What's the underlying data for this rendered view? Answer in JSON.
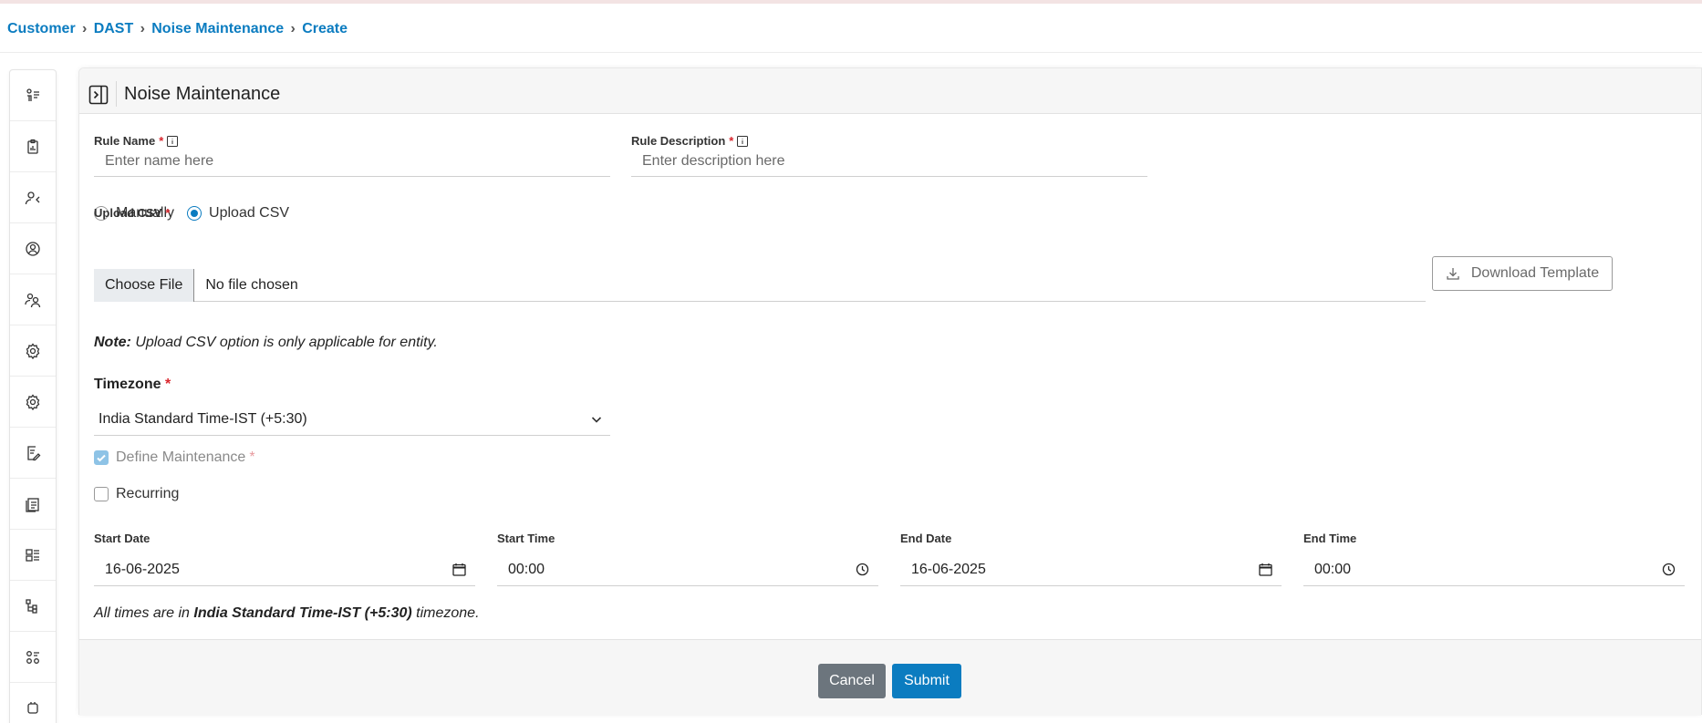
{
  "breadcrumb": {
    "items": [
      "Customer",
      "DAST",
      "Noise Maintenance",
      "Create"
    ],
    "separator": "›"
  },
  "sidebar": {
    "items": [
      {
        "icon": "person-list-icon"
      },
      {
        "icon": "clipboard-icon"
      },
      {
        "icon": "user-arrow-icon"
      },
      {
        "icon": "user-circle-icon"
      },
      {
        "icon": "users-icon"
      },
      {
        "icon": "gear-icon"
      },
      {
        "icon": "gear-alt-icon"
      },
      {
        "icon": "document-edit-icon"
      },
      {
        "icon": "document-list-icon"
      },
      {
        "icon": "stack-icon"
      },
      {
        "icon": "hierarchy-icon"
      },
      {
        "icon": "grid-list-icon"
      },
      {
        "icon": "badge-icon"
      }
    ]
  },
  "card": {
    "title": "Noise Maintenance"
  },
  "form": {
    "rule_name": {
      "label": "Rule Name",
      "required": "*",
      "placeholder": "Enter name here",
      "value": ""
    },
    "rule_description": {
      "label": "Rule Description",
      "required": "*",
      "placeholder": "Enter description here",
      "value": ""
    },
    "input_mode": {
      "options": [
        "Manually",
        "Upload CSV"
      ],
      "selected": "Upload CSV"
    },
    "upload_csv": {
      "label": "Upload CSV",
      "required": "*",
      "button": "Choose File",
      "status": "No file chosen"
    },
    "download_template": "Download Template",
    "note": {
      "prefix": "Note:",
      "text": "Upload CSV option is only applicable for entity."
    },
    "timezone": {
      "label": "Timezone",
      "required": "*",
      "value": "India Standard Time-IST (+5:30)"
    },
    "define_maintenance": {
      "label": "Define Maintenance",
      "required": "*",
      "checked": true,
      "disabled": true
    },
    "recurring": {
      "label": "Recurring",
      "checked": false
    },
    "start_date": {
      "label": "Start Date",
      "value": "16-06-2025"
    },
    "start_time": {
      "label": "Start Time",
      "value": "00:00"
    },
    "end_date": {
      "label": "End Date",
      "value": "16-06-2025"
    },
    "end_time": {
      "label": "End Time",
      "value": "00:00"
    },
    "tz_hint": {
      "prefix": "All times are in",
      "zone": "India Standard Time-IST (+5:30)",
      "suffix": "timezone."
    }
  },
  "actions": {
    "cancel": "Cancel",
    "submit": "Submit"
  },
  "colors": {
    "accent": "#0b7cc0",
    "cancel": "#6c757d",
    "required": "#d9252c"
  }
}
